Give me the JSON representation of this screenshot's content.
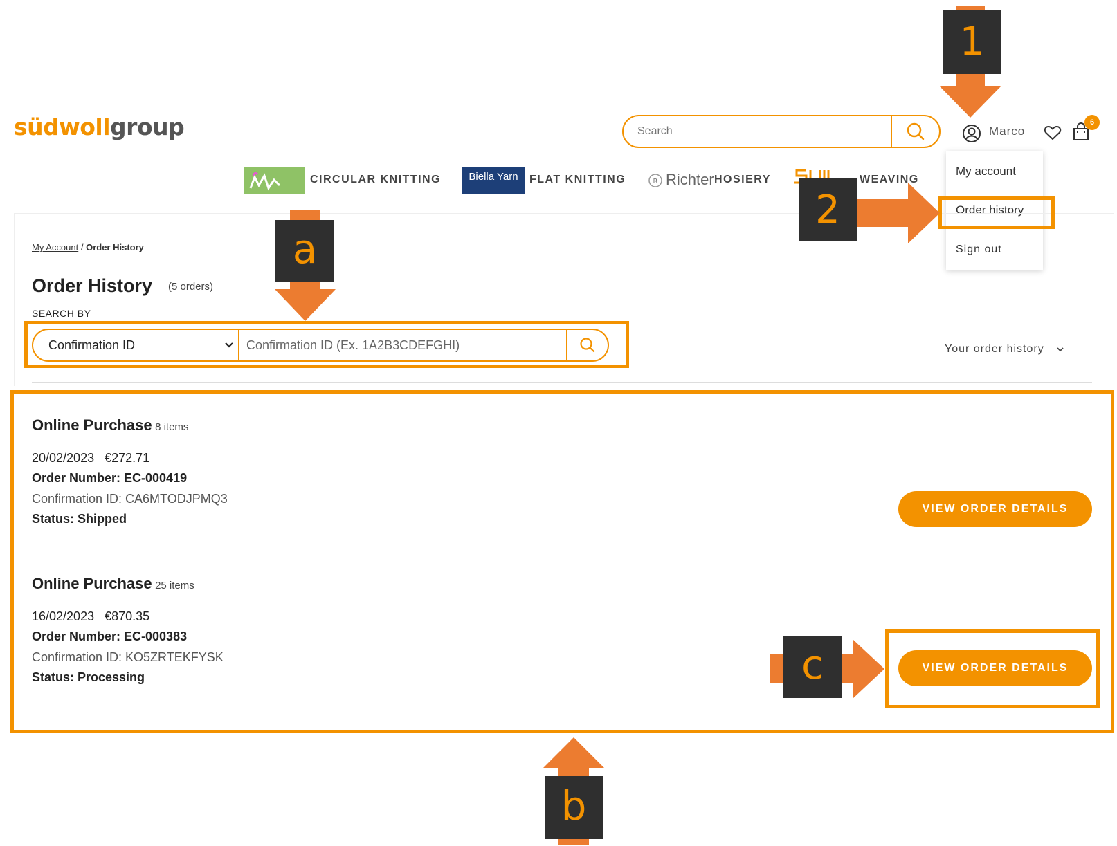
{
  "header": {
    "logo_part1": "südwoll",
    "logo_part2": "group",
    "search_placeholder": "Search",
    "user_name": "Marco",
    "cart_count": "6"
  },
  "account_menu": {
    "items": [
      "My account",
      "Order history",
      "Sign out"
    ]
  },
  "nav": {
    "items": [
      {
        "label": "CIRCULAR KNITTING"
      },
      {
        "logo_text": "Biella Yarn",
        "label": "FLAT KNITTING"
      },
      {
        "logo_text": "Richter",
        "label": "HOSIERY"
      },
      {
        "label": "WEAVING"
      }
    ]
  },
  "breadcrumb": {
    "link": "My Account",
    "separator": "/",
    "current": "Order History"
  },
  "page": {
    "title": "Order History",
    "count": "(5 orders)",
    "search_by_label": "SEARCH BY",
    "search_type": "Confirmation ID",
    "search_placeholder": "Confirmation ID (Ex. 1A2B3CDEFGHI)",
    "sort_label": "Your order history"
  },
  "orders": [
    {
      "title": "Online Purchase",
      "items": "8 items",
      "date": "20/02/2023",
      "total": "€272.71",
      "order_number": "Order Number: EC-000419",
      "confirmation": "Confirmation ID: CA6MTODJPMQ3",
      "status": "Status: Shipped",
      "button": "VIEW ORDER DETAILS"
    },
    {
      "title": "Online Purchase",
      "items": "25 items",
      "date": "16/02/2023",
      "total": "€870.35",
      "order_number": "Order Number: EC-000383",
      "confirmation": "Confirmation ID: KO5ZRTEKFYSK",
      "status": "Status: Processing",
      "button": "VIEW ORDER DETAILS"
    }
  ],
  "annotations": {
    "step1": "1",
    "step2": "2",
    "step_a": "a",
    "step_b": "b",
    "step_c": "c"
  },
  "colors": {
    "brand_orange": "#f39200",
    "annotation_arrow": "#ec7c30",
    "label_background": "#2f2f2f"
  }
}
